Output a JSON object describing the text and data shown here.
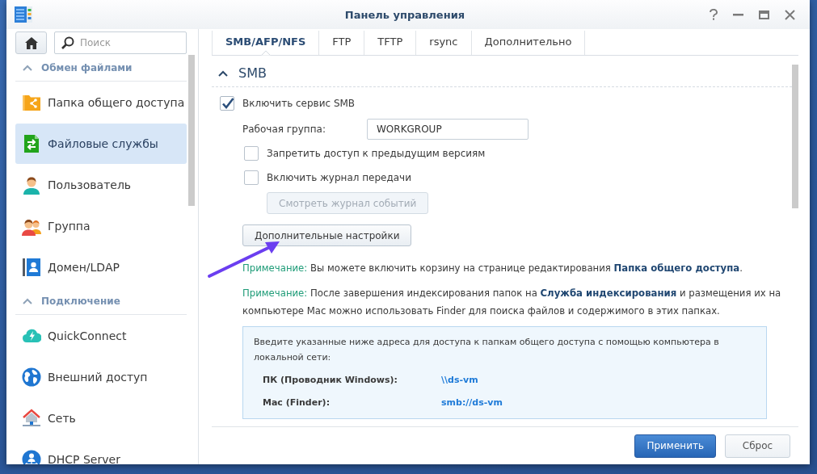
{
  "window": {
    "title": "Панель управления"
  },
  "sidebar": {
    "search": {
      "placeholder": "Поиск"
    },
    "sections": [
      {
        "title": "Обмен файлами",
        "expanded": true,
        "items": [
          {
            "label": "Папка общего доступа",
            "kind": "folder",
            "selected": false
          },
          {
            "label": "Файловые службы",
            "kind": "transfer",
            "selected": true
          },
          {
            "label": "Пользователь",
            "kind": "user",
            "selected": false
          },
          {
            "label": "Группа",
            "kind": "group",
            "selected": false
          },
          {
            "label": "Домен/LDAP",
            "kind": "directory",
            "selected": false
          }
        ]
      },
      {
        "title": "Подключение",
        "expanded": true,
        "items": [
          {
            "label": "QuickConnect",
            "kind": "cloud",
            "selected": false
          },
          {
            "label": "Внешний доступ",
            "kind": "globe",
            "selected": false
          },
          {
            "label": "Сеть",
            "kind": "house",
            "selected": false
          },
          {
            "label": "DHCP Server",
            "kind": "hub",
            "selected": false
          }
        ]
      }
    ]
  },
  "tabs": [
    {
      "label": "SMB/AFP/NFS",
      "selected": true
    },
    {
      "label": "FTP",
      "selected": false
    },
    {
      "label": "TFTP",
      "selected": false
    },
    {
      "label": "rsync",
      "selected": false
    },
    {
      "label": "Дополнительно",
      "selected": false
    }
  ],
  "smb": {
    "title": "SMB",
    "expanded": true,
    "enable": {
      "label": "Включить сервис SMB",
      "checked": true
    },
    "workgroup": {
      "label": "Рабочая группа:",
      "value": "WORKGROUP"
    },
    "options": [
      {
        "label": "Запретить доступ к предыдущим версиям",
        "checked": false
      },
      {
        "label": "Включить журнал передачи",
        "checked": false
      }
    ],
    "log_button": {
      "label": "Смотреть журнал событий",
      "disabled": true
    },
    "advanced_button": {
      "label": "Дополнительные настройки",
      "disabled": false
    }
  },
  "notes": [
    {
      "prefix": "Примечание:",
      "text": "Вы можете включить корзину на странице редактирования **Папка общего доступа**."
    },
    {
      "prefix": "Примечание:",
      "text": "После завершения индексирования папок на **Служба индексирования** и размещения их на компьютере Mac можно использовать Finder для поиска файлов и содержимого в этих папках."
    }
  ],
  "info_box": {
    "text": "Введите указанные ниже адреса для доступа к папкам общего доступа с помощью компьютера в локальной сети:",
    "rows": [
      {
        "label": "ПК (Проводник Windows):",
        "value": "\\\\ds-vm"
      },
      {
        "label": "Mac (Finder):",
        "value": "smb://ds-vm"
      }
    ]
  },
  "footer": {
    "buttons": [
      {
        "label": "Применить",
        "kind": "primary"
      },
      {
        "label": "Сброс",
        "kind": "default"
      }
    ]
  }
}
